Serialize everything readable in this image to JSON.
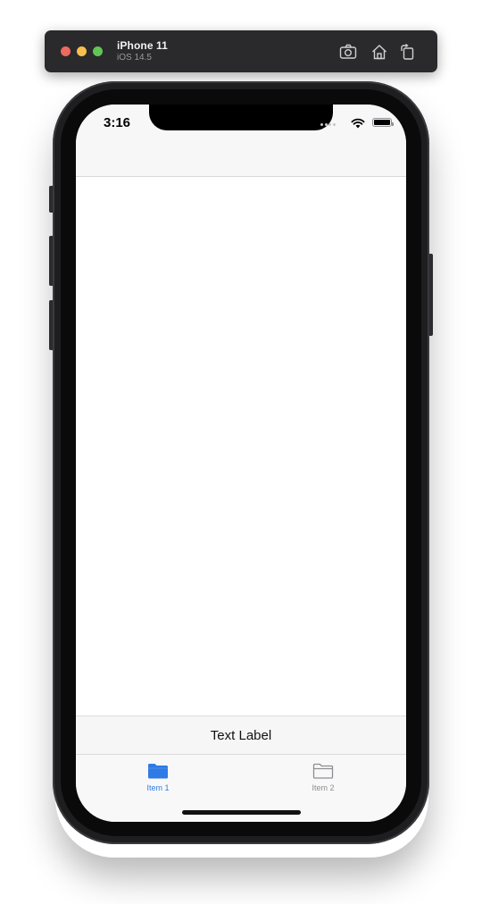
{
  "simulator": {
    "device_name": "iPhone 11",
    "os_version": "iOS 14.5",
    "icons": [
      "screenshot-icon",
      "home-icon",
      "rotate-icon"
    ]
  },
  "status_bar": {
    "time": "3:16"
  },
  "content": {
    "label_text": "Text Label"
  },
  "tab_bar": {
    "tabs": [
      {
        "label": "Item 1",
        "icon": "folder-filled-icon",
        "selected": true
      },
      {
        "label": "Item 2",
        "icon": "folder-outline-icon",
        "selected": false
      }
    ],
    "selected_color": "#2f7ae5",
    "unselected_color": "#8e8e93"
  }
}
